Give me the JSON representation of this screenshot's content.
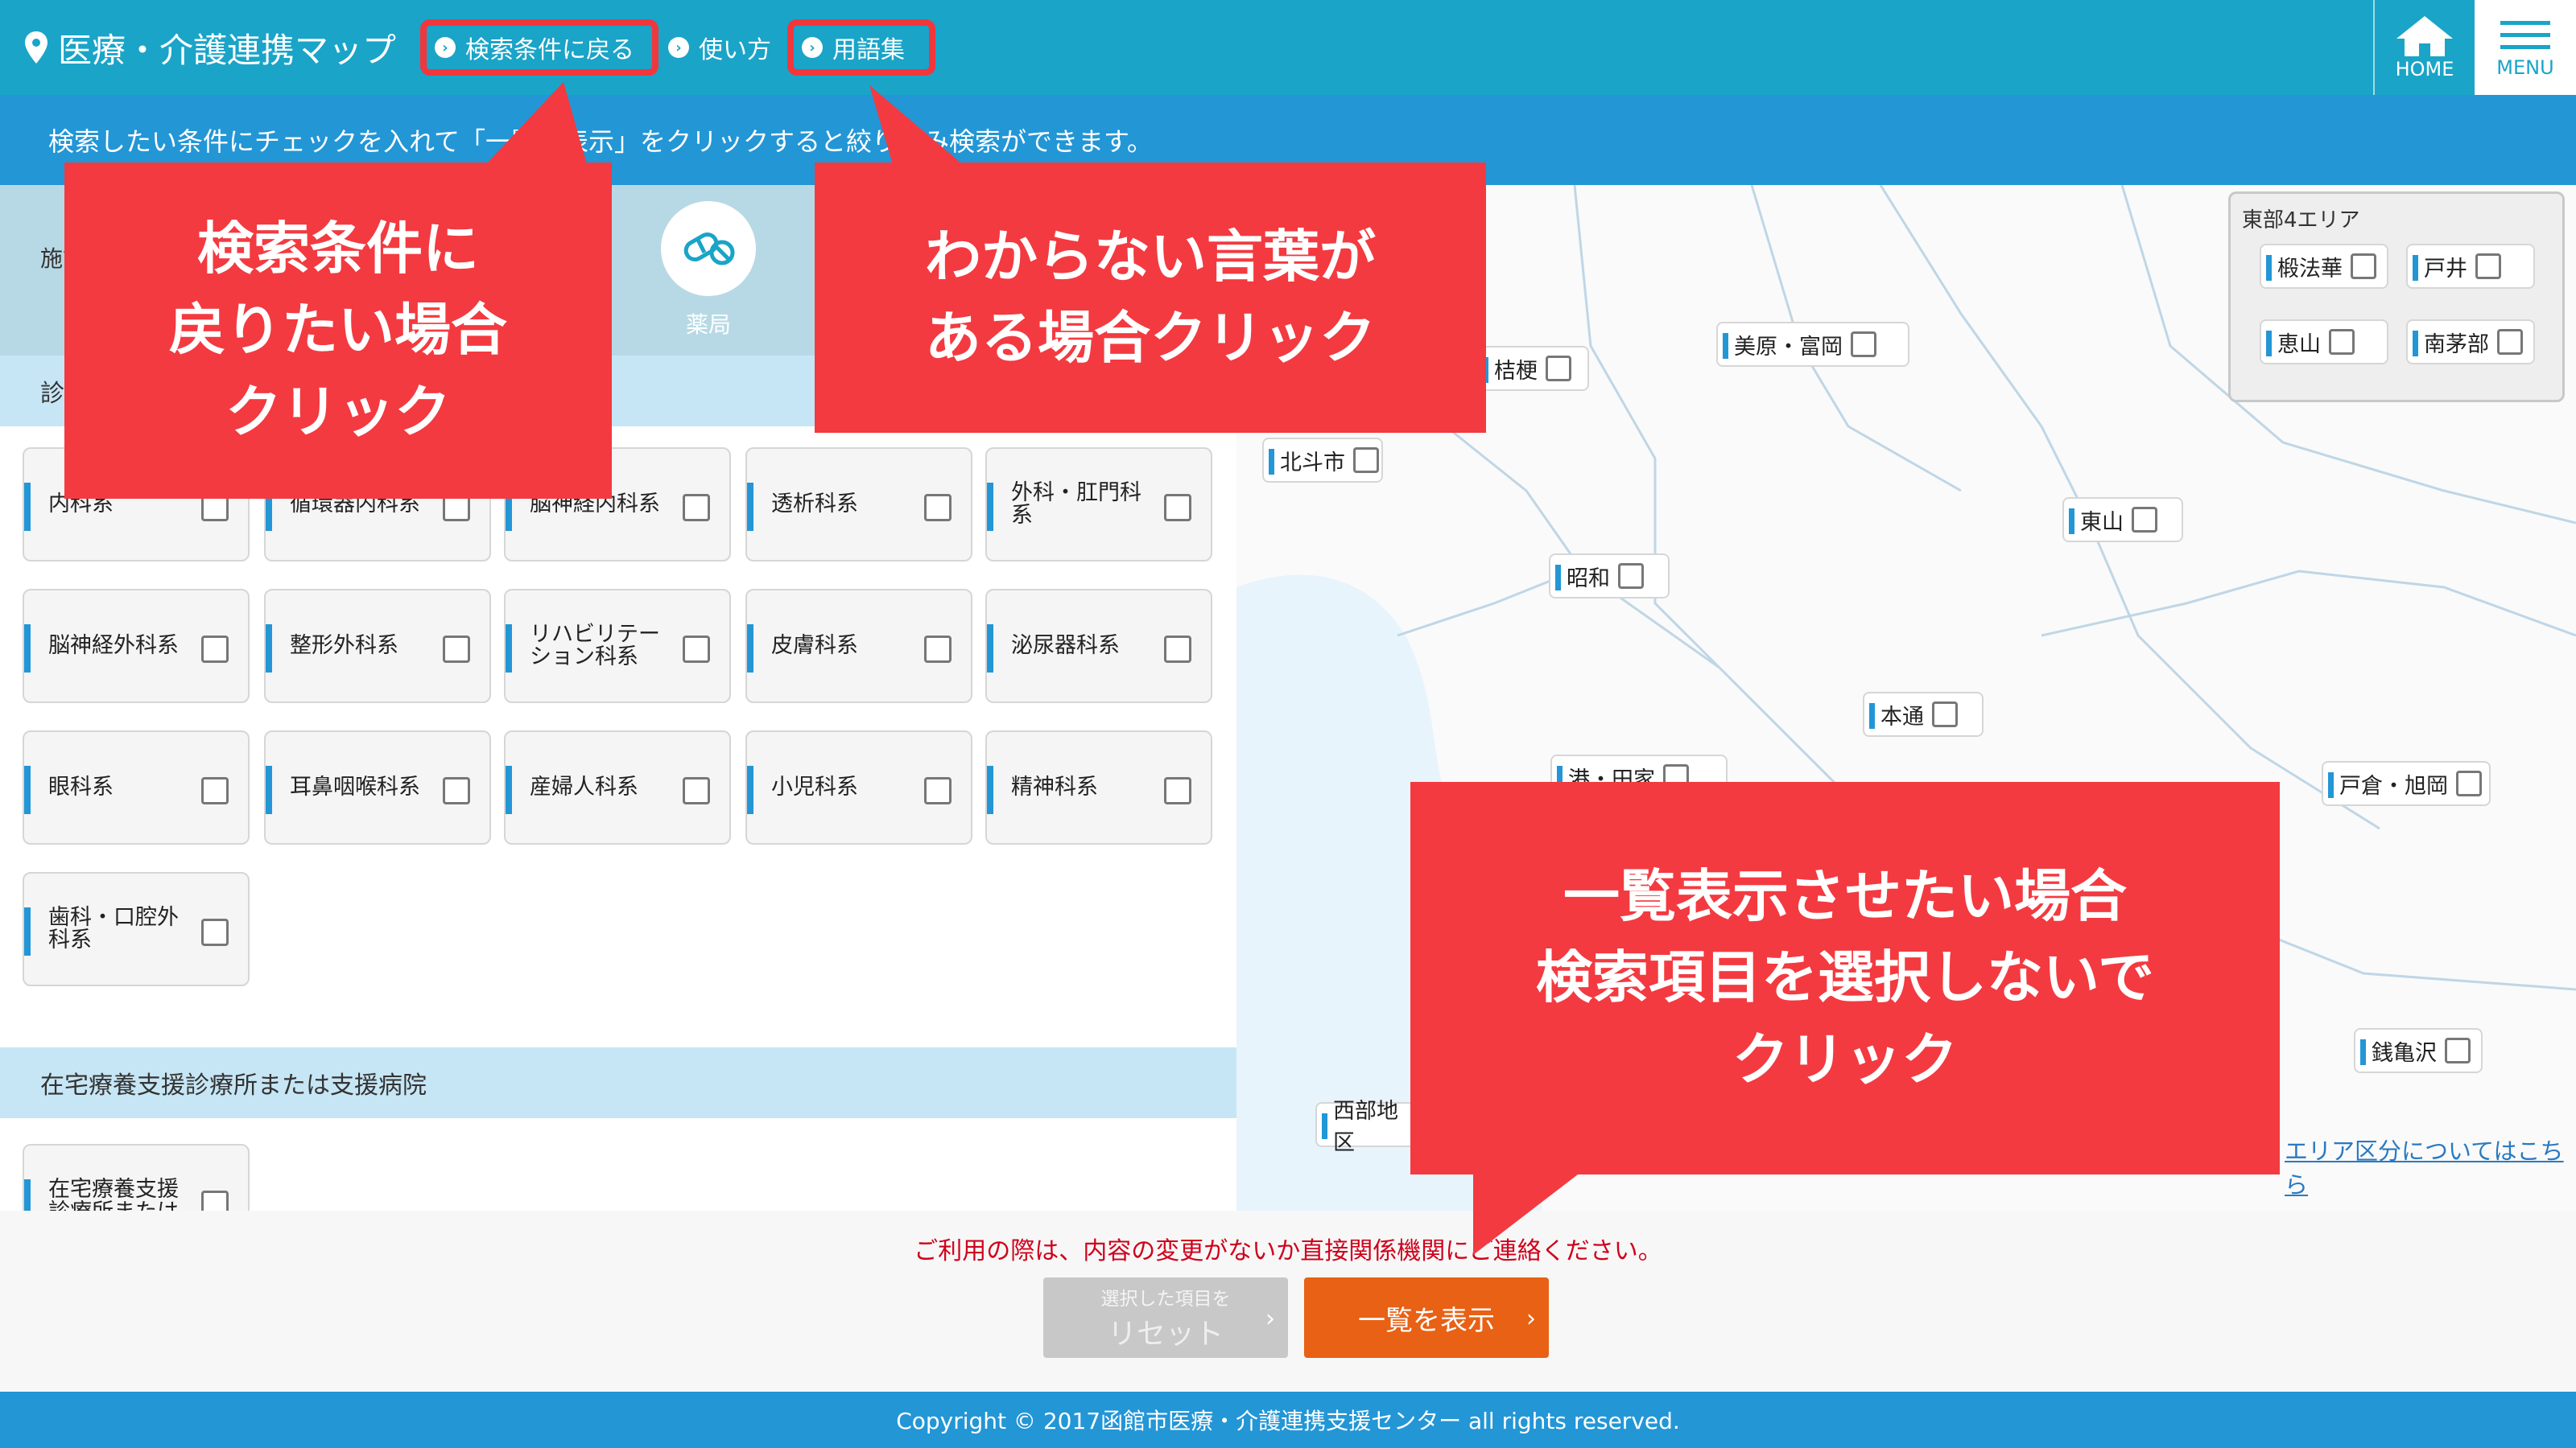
{
  "header": {
    "title": "医療・介護連携マップ",
    "nav": [
      "検索条件に戻る",
      "使い方",
      "用語集"
    ],
    "home_label": "HOME",
    "menu_label": "MENU"
  },
  "info_bar": "検索したい条件にチェックを入れて「一覧を表示」をクリックすると絞り込み検索ができます。",
  "facility_tabs": {
    "partial_label": "施設",
    "pharmacy": "薬局"
  },
  "sections": {
    "clinic_partial": "診",
    "home_care": "在宅療養支援診療所または支援病院"
  },
  "departments": [
    "内科系",
    "循環器内科系",
    "脳神経内科系",
    "透析科系",
    "外科・肛門科系",
    "脳神経外科系",
    "整形外科系",
    "リハビリテーション科系",
    "皮膚科系",
    "泌尿器科系",
    "眼科系",
    "耳鼻咽喉科系",
    "産婦人科系",
    "小児科系",
    "精神科系",
    "歯科・口腔外科系"
  ],
  "home_care_items": [
    "在宅療養支援診療所または"
  ],
  "map": {
    "areas": [
      "桔梗",
      "美原・富岡",
      "北斗市",
      "東山",
      "昭和",
      "本通",
      "港・田家",
      "戸倉・旭岡",
      "銭亀沢",
      "西部地区"
    ],
    "east4_title": "東部4エリア",
    "east4_items": [
      "椴法華",
      "戸井",
      "恵山",
      "南茅部"
    ],
    "area_link": "エリア区分についてはこちら"
  },
  "notice": "ご利用の際は、内容の変更がないか直接関係機関にご連絡ください。",
  "buttons": {
    "reset_small": "選択した項目を",
    "reset": "リセット",
    "show": "一覧を表示"
  },
  "copyright": "Copyright © 2017函館市医療・介護連携支援センター all rights reserved.",
  "callouts": {
    "back_line1": "検索条件に",
    "back_line2": "戻りたい場合",
    "back_line3": "クリック",
    "glossary_line1": "わからない言葉が",
    "glossary_line2": "ある場合クリック",
    "list_line1": "一覧表示させたい場合",
    "list_line2": "検索項目を選択しないで",
    "list_line3": "クリック"
  },
  "colors": {
    "header": "#1aa4c8",
    "info_bar": "#2396d6",
    "callout": "#f33a40",
    "show_button": "#e86114",
    "reset_button": "#c8c8c8",
    "notice": "#d0021b"
  }
}
